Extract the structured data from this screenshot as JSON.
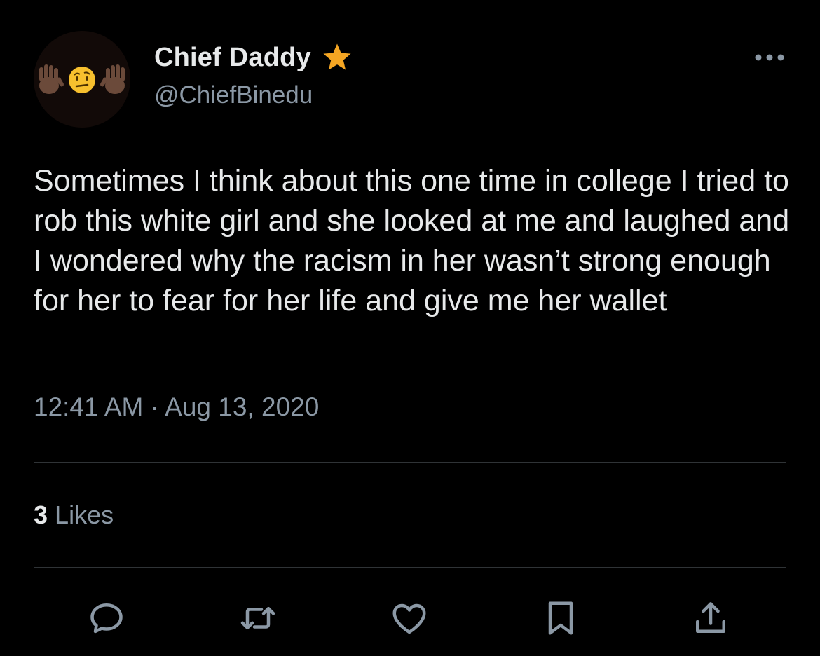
{
  "author": {
    "display_name": "Chief Daddy",
    "handle": "@ChiefBinedu",
    "badge_icon": "star-icon",
    "badge_color": "#f5a623"
  },
  "tweet": {
    "text": "Sometimes I think about this one time in college I tried to rob this white girl and she looked at me and laughed and I wondered why the racism in her wasn’t strong enough for her to fear for her life and give me her wallet",
    "timestamp": "12:41 AM · Aug 13, 2020"
  },
  "stats": {
    "likes_count": "3",
    "likes_label": "Likes"
  },
  "actions": [
    {
      "name": "reply",
      "icon": "reply-icon"
    },
    {
      "name": "retweet",
      "icon": "retweet-icon"
    },
    {
      "name": "like",
      "icon": "heart-icon"
    },
    {
      "name": "bookmark",
      "icon": "bookmark-icon"
    },
    {
      "name": "share",
      "icon": "share-icon"
    }
  ],
  "colors": {
    "background": "#000000",
    "text_primary": "#e7e9ea",
    "text_secondary": "#8b98a5",
    "divider": "#2f3336",
    "icon": "#8b98a5"
  }
}
